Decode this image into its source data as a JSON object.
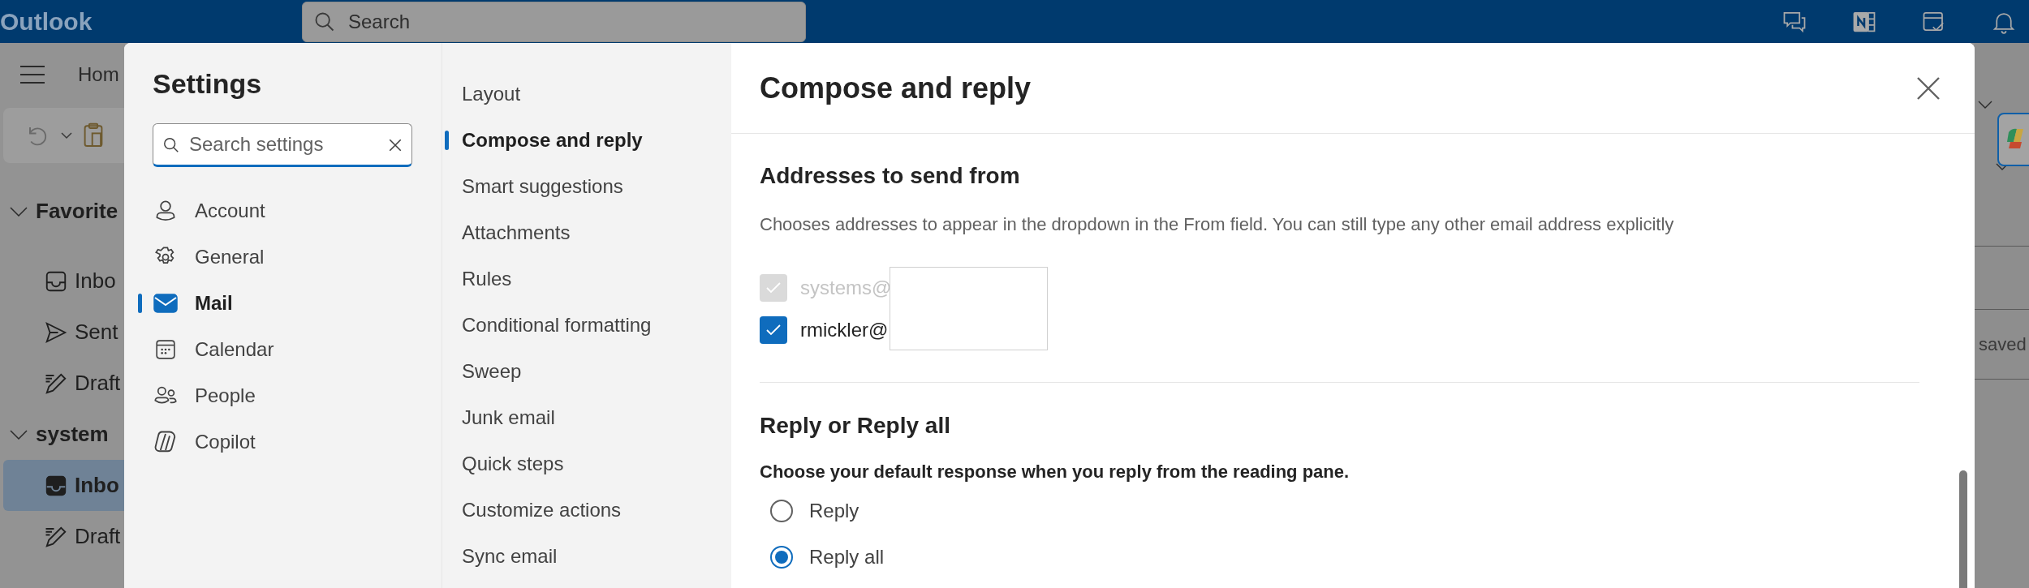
{
  "app": {
    "name": "Outlook"
  },
  "search": {
    "placeholder": "Search"
  },
  "background": {
    "home_tab": "Hom",
    "folders": [
      {
        "label": "Favorite",
        "expanded": true,
        "children": [
          {
            "label": "Inbo",
            "kind": "inbox",
            "selected": false
          },
          {
            "label": "Sent",
            "kind": "sent",
            "selected": false
          },
          {
            "label": "Draft",
            "kind": "drafts",
            "selected": false
          }
        ]
      },
      {
        "label": "system",
        "expanded": true,
        "children": [
          {
            "label": "Inbo",
            "kind": "inbox",
            "selected": true
          },
          {
            "label": "Draft",
            "kind": "drafts",
            "selected": false
          }
        ]
      }
    ],
    "right_text": "saved"
  },
  "settings": {
    "title": "Settings",
    "search": {
      "placeholder": "Search settings"
    },
    "categories": [
      {
        "label": "Account",
        "selected": false
      },
      {
        "label": "General",
        "selected": false
      },
      {
        "label": "Mail",
        "selected": true
      },
      {
        "label": "Calendar",
        "selected": false
      },
      {
        "label": "People",
        "selected": false
      },
      {
        "label": "Copilot",
        "selected": false
      }
    ],
    "subcategories": [
      {
        "label": "Layout",
        "selected": false
      },
      {
        "label": "Compose and reply",
        "selected": true
      },
      {
        "label": "Smart suggestions",
        "selected": false
      },
      {
        "label": "Attachments",
        "selected": false
      },
      {
        "label": "Rules",
        "selected": false
      },
      {
        "label": "Conditional formatting",
        "selected": false
      },
      {
        "label": "Sweep",
        "selected": false
      },
      {
        "label": "Junk email",
        "selected": false
      },
      {
        "label": "Quick steps",
        "selected": false
      },
      {
        "label": "Customize actions",
        "selected": false
      },
      {
        "label": "Sync email",
        "selected": false
      }
    ],
    "page": {
      "title": "Compose and reply",
      "addresses": {
        "heading": "Addresses to send from",
        "description": "Chooses addresses to appear in the dropdown in the From field. You can still type any other email address explicitly",
        "items": [
          {
            "label": "systems@",
            "checked": true,
            "disabled": true
          },
          {
            "label": "rmickler@",
            "checked": true,
            "disabled": false
          }
        ]
      },
      "reply": {
        "heading": "Reply or Reply all",
        "description": "Choose your default response when you reply from the reading pane.",
        "options": [
          {
            "label": "Reply",
            "selected": false
          },
          {
            "label": "Reply all",
            "selected": true
          }
        ]
      }
    }
  }
}
